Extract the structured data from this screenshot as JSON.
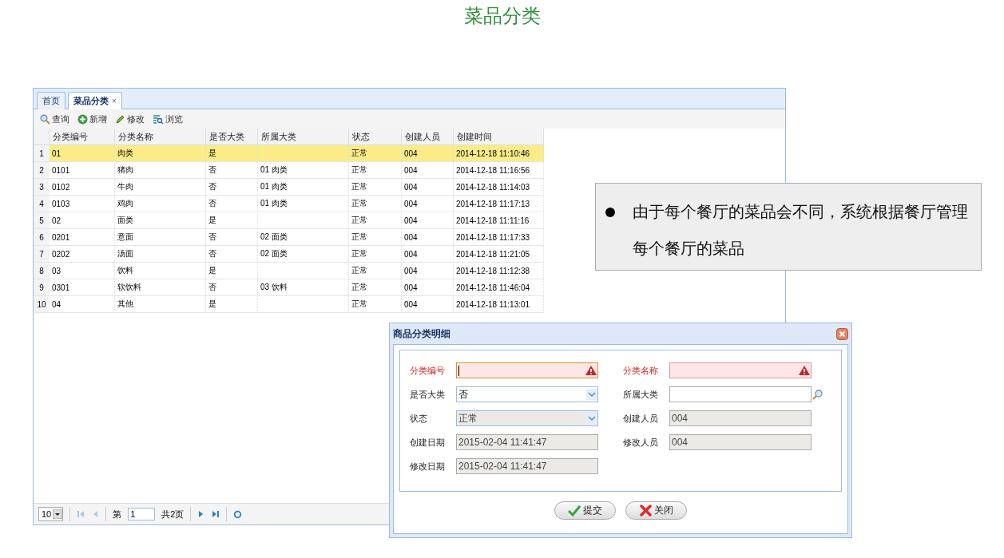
{
  "page_title": "菜品分类",
  "window": {
    "tabs": [
      {
        "label": "首页",
        "selected": false
      },
      {
        "label": "菜品分类",
        "selected": true,
        "close_glyph": "×"
      }
    ],
    "toolbar": [
      {
        "kind": "search",
        "label": "查询"
      },
      {
        "kind": "add",
        "label": "新增"
      },
      {
        "kind": "edit",
        "label": "修改"
      },
      {
        "kind": "browse",
        "label": "浏览"
      }
    ],
    "table": {
      "columns": [
        "分类编号",
        "分类名称",
        "是否大类",
        "所属大类",
        "状态",
        "创建人员",
        "创建时间"
      ],
      "rows": [
        {
          "number": "1",
          "selected": true,
          "cells": [
            "01",
            "肉类",
            "是",
            "",
            "正常",
            "004",
            "2014-12-18 11:10:46"
          ]
        },
        {
          "number": "2",
          "selected": false,
          "cells": [
            "0101",
            "猪肉",
            "否",
            "01 肉类",
            "正常",
            "004",
            "2014-12-18 11:16:56"
          ]
        },
        {
          "number": "3",
          "selected": false,
          "cells": [
            "0102",
            "牛肉",
            "否",
            "01 肉类",
            "正常",
            "004",
            "2014-12-18 11:14:03"
          ]
        },
        {
          "number": "4",
          "selected": false,
          "cells": [
            "0103",
            "鸡肉",
            "否",
            "01 肉类",
            "正常",
            "004",
            "2014-12-18 11:17:13"
          ]
        },
        {
          "number": "5",
          "selected": false,
          "cells": [
            "02",
            "面类",
            "是",
            "",
            "正常",
            "004",
            "2014-12-18 11:11:16"
          ]
        },
        {
          "number": "6",
          "selected": false,
          "cells": [
            "0201",
            "意面",
            "否",
            "02 面类",
            "正常",
            "004",
            "2014-12-18 11:17:33"
          ]
        },
        {
          "number": "7",
          "selected": false,
          "cells": [
            "0202",
            "汤面",
            "否",
            "02 面类",
            "正常",
            "004",
            "2014-12-18 11:21:05"
          ]
        },
        {
          "number": "8",
          "selected": false,
          "cells": [
            "03",
            "饮料",
            "是",
            "",
            "正常",
            "004",
            "2014-12-18 11:12:38"
          ]
        },
        {
          "number": "9",
          "selected": false,
          "cells": [
            "0301",
            "软饮料",
            "否",
            "03 饮料",
            "正常",
            "004",
            "2014-12-18 11:46:04"
          ]
        },
        {
          "number": "10",
          "selected": false,
          "cells": [
            "04",
            "其他",
            "是",
            "",
            "正常",
            "004",
            "2014-12-18 11:13:01"
          ]
        }
      ]
    },
    "pager": {
      "page_size": "10",
      "page_prefix": "第",
      "page_value": "1",
      "page_suffix": "共2页"
    }
  },
  "note": {
    "text": "由于每个餐厅的菜品会不同，系统根据餐厅管理每个餐厅的菜品"
  },
  "dialog": {
    "title": "商品分类明细",
    "fields": [
      {
        "label": "分类编号",
        "kind": "text",
        "required": true,
        "focused": true,
        "disabled": false
      },
      {
        "label": "分类名称",
        "kind": "text",
        "required": true,
        "focused": false,
        "disabled": false
      },
      {
        "label": "是否大类",
        "kind": "combo",
        "value": "否",
        "required": false,
        "focused": false,
        "disabled": false
      },
      {
        "label": "所属大类",
        "kind": "lookup",
        "required": false,
        "focused": false,
        "disabled": false
      },
      {
        "label": "状态",
        "kind": "combo",
        "value": "正常",
        "required": false,
        "focused": false,
        "disabled": true
      },
      {
        "label": "创建人员",
        "kind": "text",
        "value": "004",
        "required": false,
        "focused": false,
        "disabled": true
      },
      {
        "label": "创建日期",
        "kind": "text",
        "value": "2015-02-04 11:41:47",
        "required": false,
        "focused": false,
        "disabled": true
      },
      {
        "label": "修改人员",
        "kind": "text",
        "value": "004",
        "required": false,
        "focused": false,
        "disabled": true
      },
      {
        "label": "修改日期",
        "kind": "text",
        "value": "2015-02-04 11:41:47",
        "required": false,
        "focused": false,
        "disabled": true
      }
    ],
    "buttons": [
      {
        "kind": "submit",
        "label": "提交"
      },
      {
        "kind": "close",
        "label": "关闭"
      }
    ]
  }
}
